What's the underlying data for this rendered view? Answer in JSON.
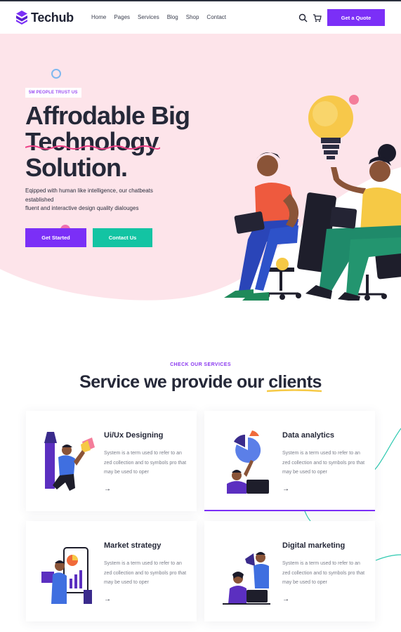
{
  "brand": {
    "name": "Techub",
    "accent": "#7b2ff7",
    "secondary": "#13c4a3",
    "hero_bg": "#fde4ea"
  },
  "nav": {
    "items": [
      "Home",
      "Pages",
      "Services",
      "Blog",
      "Shop",
      "Contact"
    ],
    "search_icon": "search-icon",
    "cart_icon": "cart-icon",
    "quote_label": "Get a Quote"
  },
  "hero": {
    "badge": "5M PEOPLE TRUST US",
    "title_line1": "Affrodable Big",
    "title_line2": "Technology",
    "title_line3": "Solution.",
    "desc_line1": "Eqipped with human like intelligence, our chatbeats",
    "desc_line2": "established",
    "desc_line3": "fluent and interactive design quality dialouges",
    "primary_btn": "Get Started",
    "secondary_btn": "Contact Us"
  },
  "services": {
    "eyebrow": "CHECK OUR SERVICES",
    "title": "Service we provide our clients",
    "cards": [
      {
        "title": "Ui/Ux Designing",
        "desc": "System is a term used to refer to an zed collection and to symbols pro that may be used to oper",
        "arrow": "→",
        "icon": "designer-illustration"
      },
      {
        "title": "Data analytics",
        "desc": "System is a term used to refer to an zed collection and to symbols pro that may be used to oper",
        "arrow": "→",
        "icon": "analytics-illustration"
      },
      {
        "title": "Market strategy",
        "desc": "System is a term used to refer to an zed collection and to symbols pro that may be used to oper",
        "arrow": "→",
        "icon": "strategy-illustration"
      },
      {
        "title": "Digital marketing",
        "desc": "System is a term used to refer to an zed collection and to symbols pro that may be used to oper",
        "arrow": "→",
        "icon": "marketing-illustration"
      }
    ]
  }
}
